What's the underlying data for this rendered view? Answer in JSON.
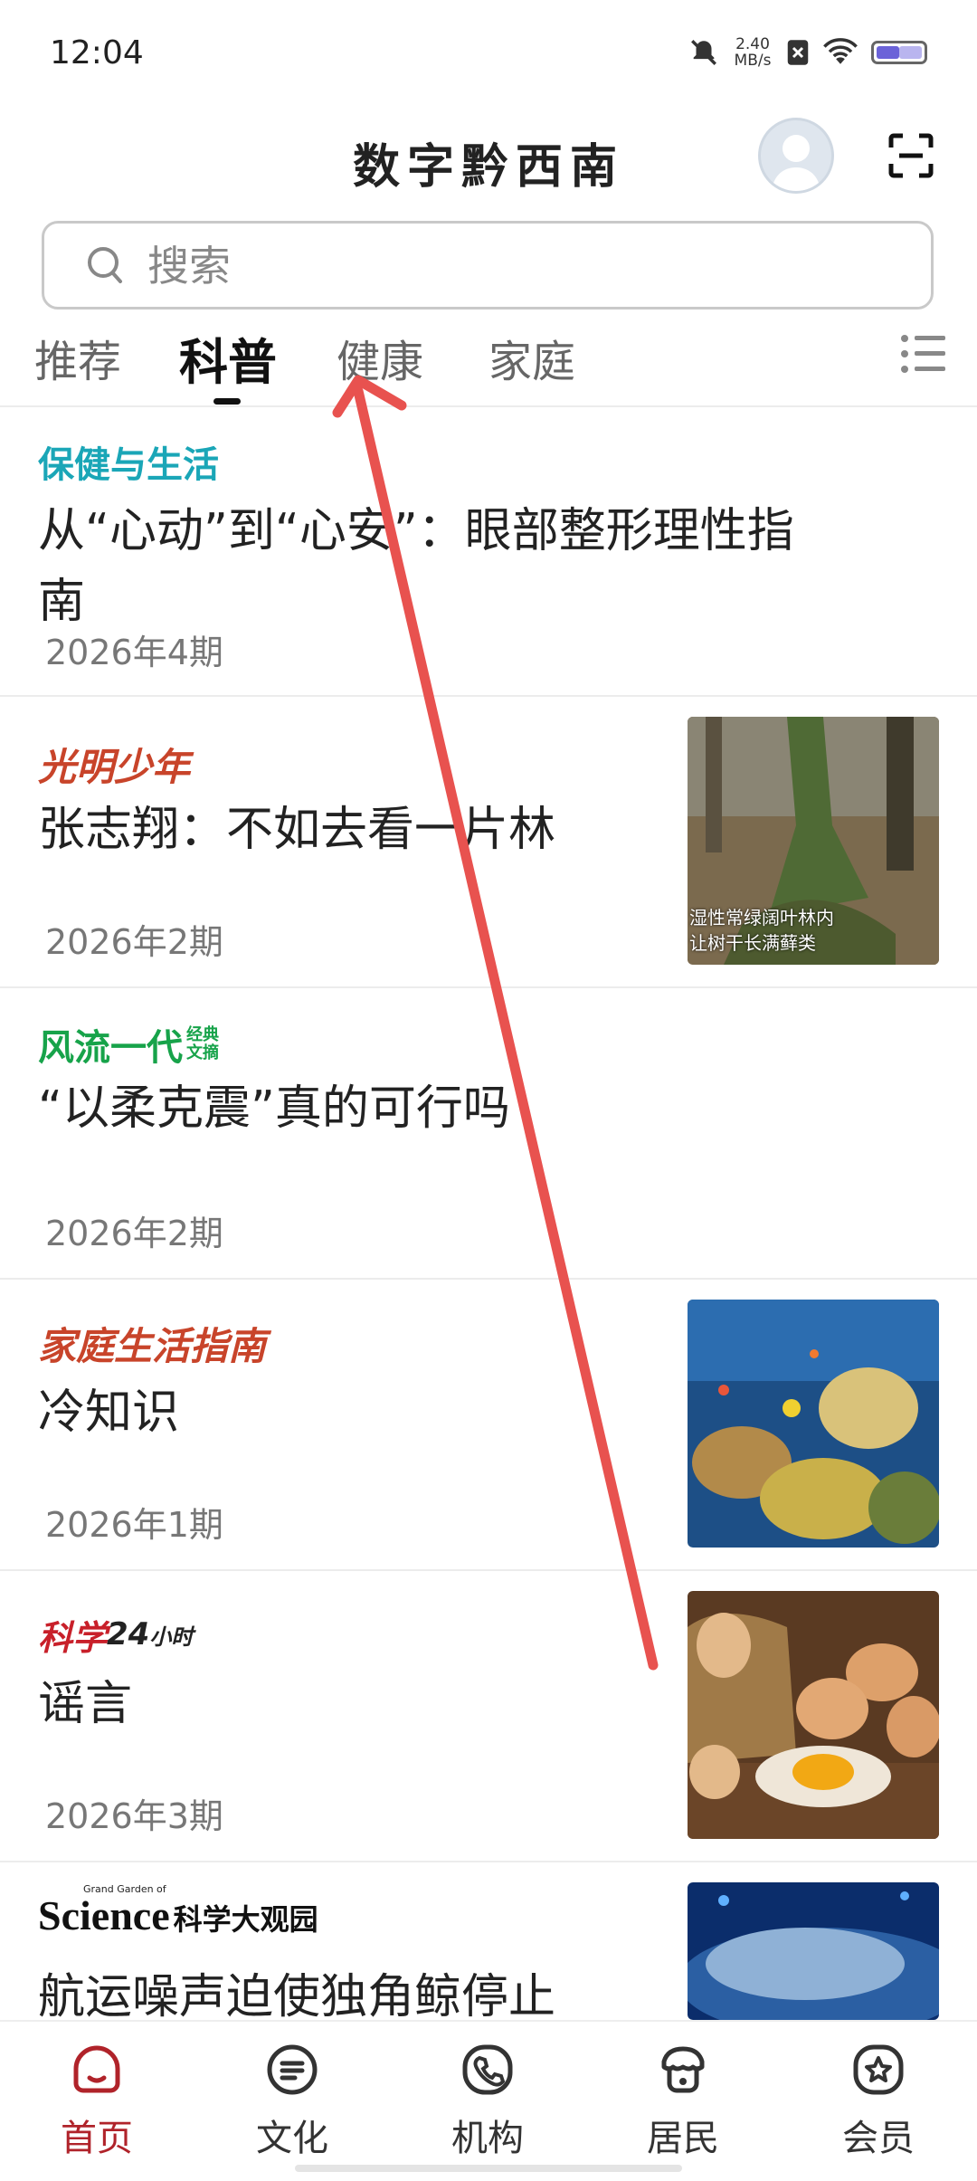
{
  "status_bar": {
    "time": "12:04",
    "net_speed_value": "2.40",
    "net_speed_unit": "MB/s",
    "icons": [
      "mute-icon",
      "sim-off-icon",
      "wifi-icon",
      "battery-icon"
    ]
  },
  "header": {
    "title": "数字黔西南",
    "icons": [
      "avatar",
      "scan-icon"
    ]
  },
  "search": {
    "placeholder": "搜索"
  },
  "tabs": [
    {
      "label": "推荐",
      "active": false
    },
    {
      "label": "科普",
      "active": true
    },
    {
      "label": "健康",
      "active": false
    },
    {
      "label": "家庭",
      "active": false
    }
  ],
  "articles": [
    {
      "brand": "保健与生活",
      "brand_color": "#1aa6b7",
      "title_line1": "从“心动”到“心安”：眼部整形理性指",
      "title_line2": "南",
      "issue": "2026年4期"
    },
    {
      "brand": "光明少年",
      "brand_color": "#c8442a",
      "title_line1": "张志翔：不如去看一片林",
      "issue": "2026年2期",
      "thumb_caption_1": "湿性常绿阔叶林内",
      "thumb_caption_2": "让树干长满藓类"
    },
    {
      "brand_main": "风流一代",
      "brand_side_1": "经典",
      "brand_side_2": "文摘",
      "brand_color": "#17a34a",
      "title_line1": "“以柔克震”真的可行吗",
      "issue": "2026年2期"
    },
    {
      "brand": "家庭生活指南",
      "brand_color": "#c8442a",
      "title_line1": "冷知识",
      "issue": "2026年1期"
    },
    {
      "brand_main": "科学",
      "brand_num": "24",
      "brand_tail": "小时",
      "brand_color": "#c8202a",
      "title_line1": "谣言",
      "issue": "2026年3期"
    },
    {
      "brand_small": "Grand Garden of",
      "brand_main": "Science",
      "brand_cn": "科学大观园",
      "title_line1": "航运噪声迫使独角鲸停止"
    }
  ],
  "bottom_nav": [
    {
      "label": "首页",
      "active": true
    },
    {
      "label": "文化",
      "active": false
    },
    {
      "label": "机构",
      "active": false
    },
    {
      "label": "居民",
      "active": false
    },
    {
      "label": "会员",
      "active": false
    }
  ],
  "colors": {
    "accent": "#b0232a",
    "annotation_arrow": "#e8524f"
  }
}
